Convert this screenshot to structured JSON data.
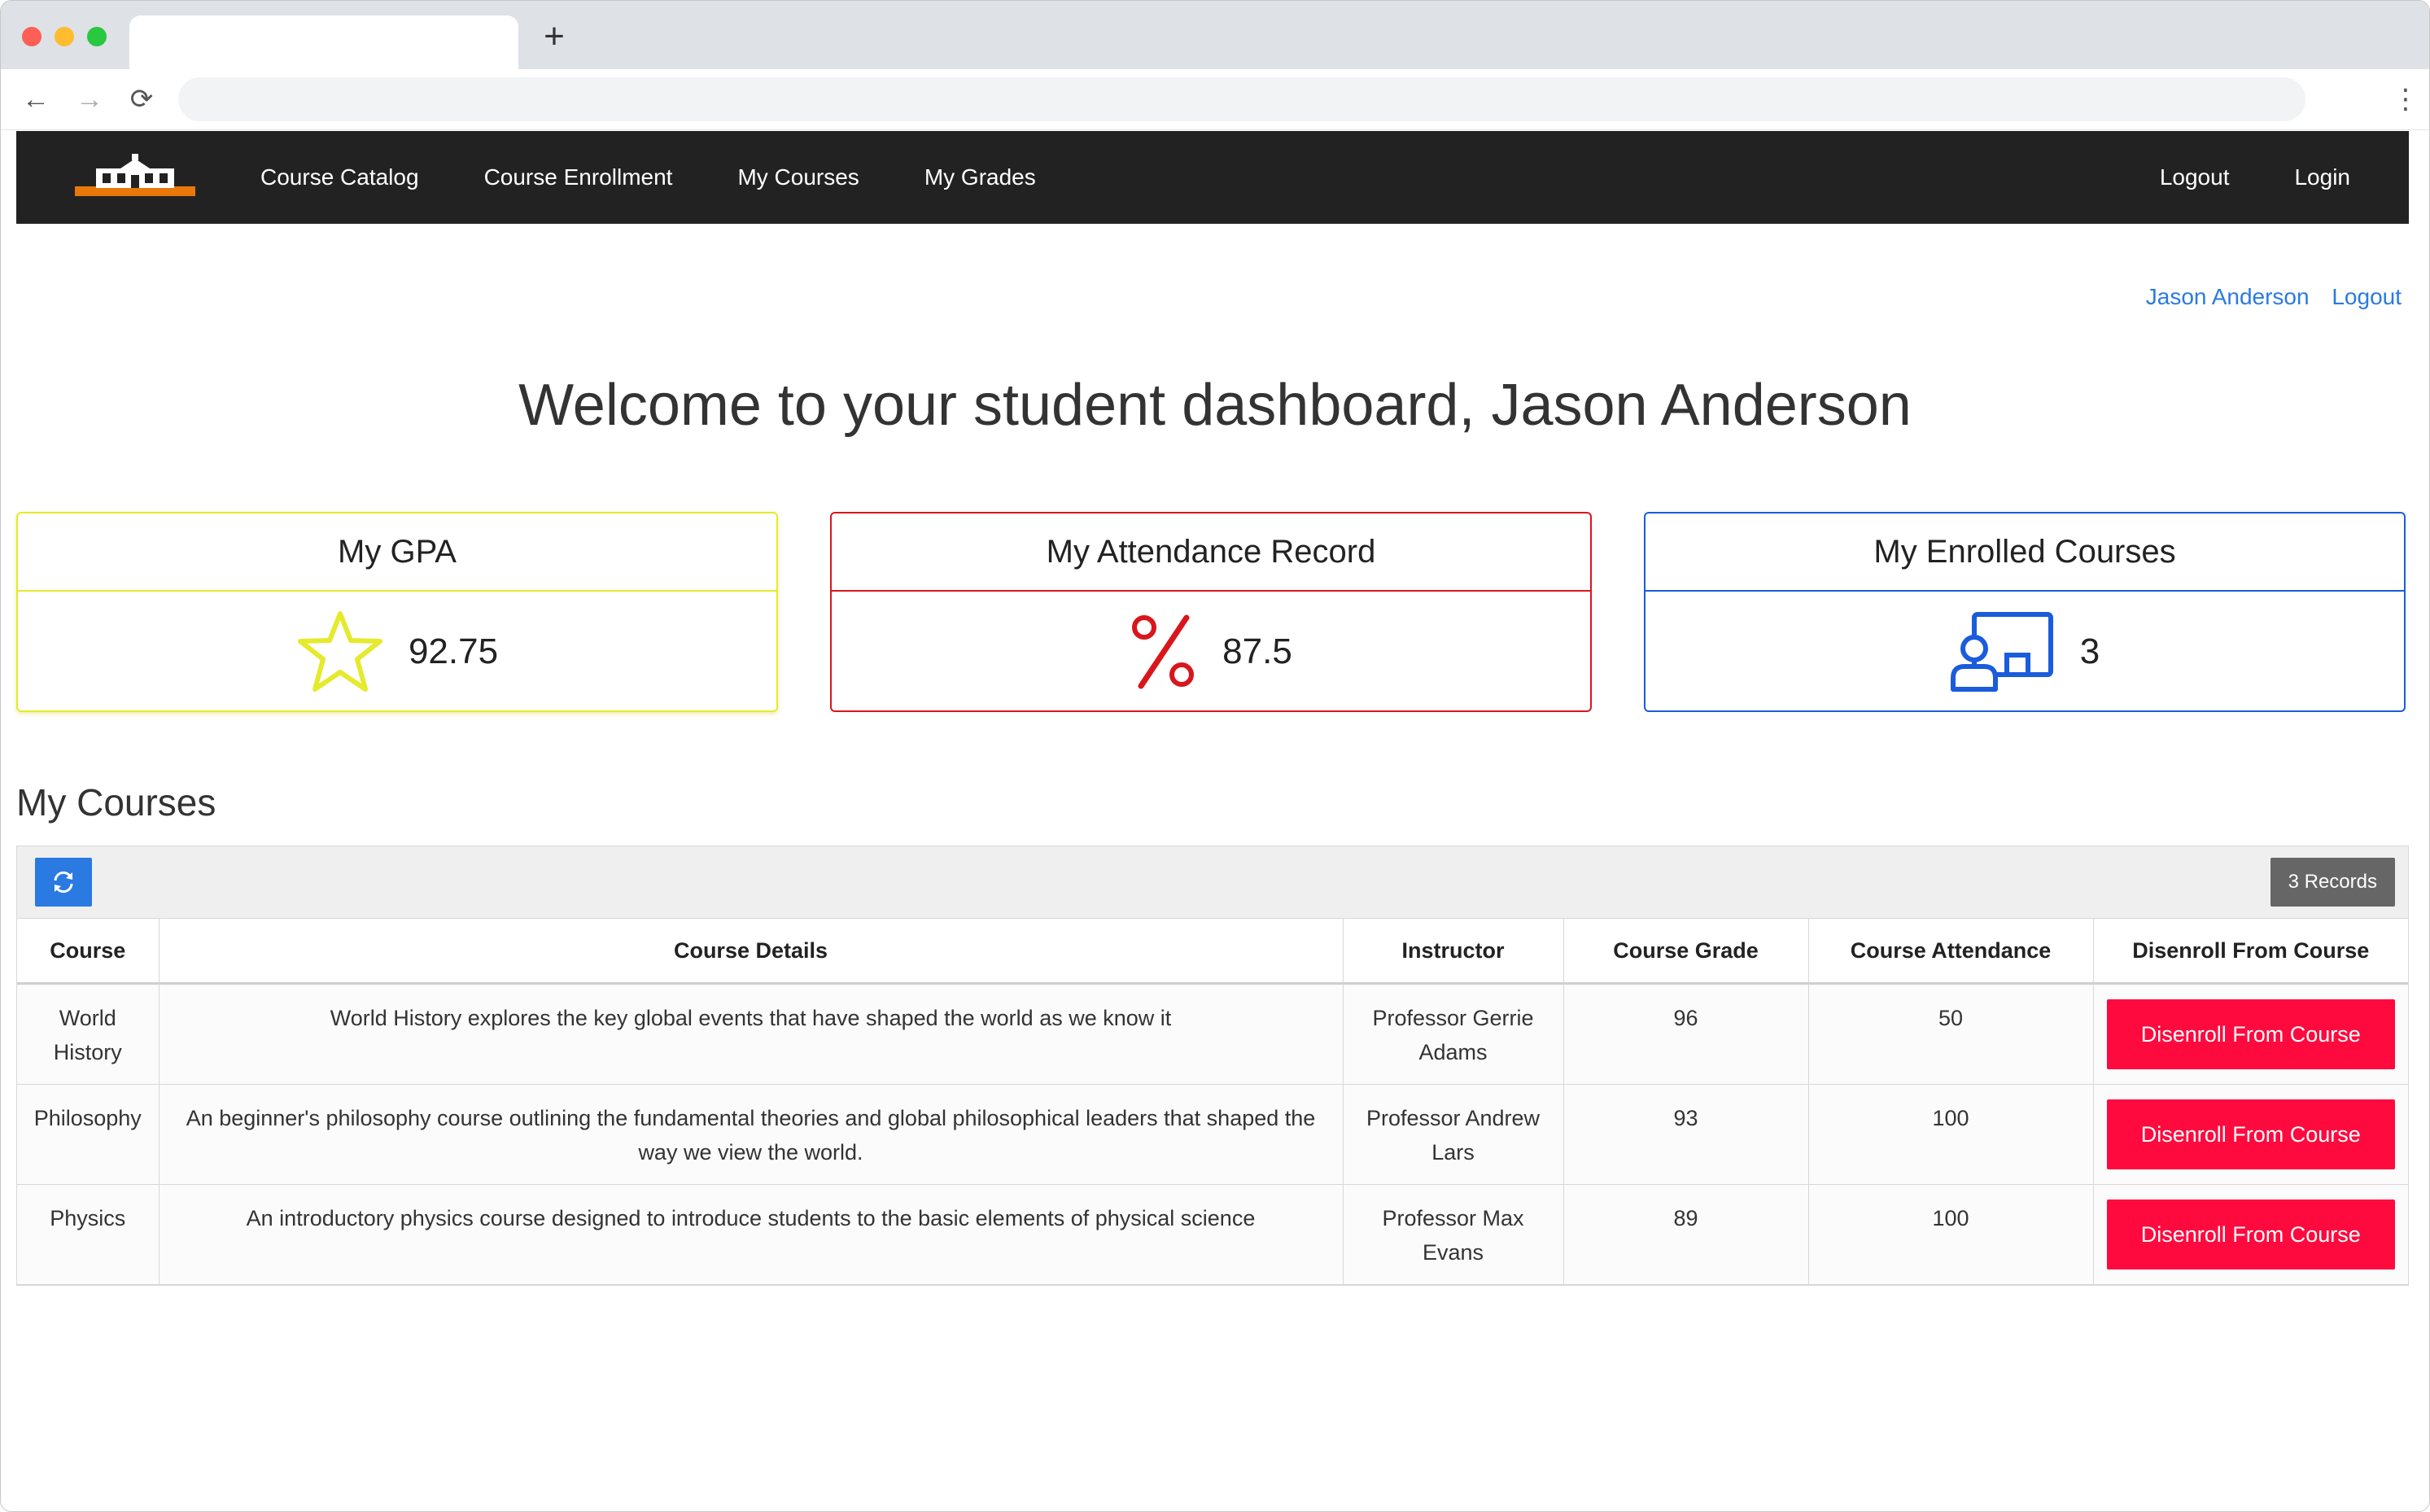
{
  "browser": {
    "url": "",
    "new_tab_symbol": "+",
    "back_symbol": "←",
    "forward_symbol": "→",
    "reload_symbol": "⟳",
    "menu_symbol": "⋮"
  },
  "navbar": {
    "logo_icon": "school-building-icon",
    "links": [
      "Course Catalog",
      "Course Enrollment",
      "My Courses",
      "My Grades"
    ],
    "right_links": [
      "Logout",
      "Login"
    ]
  },
  "user": {
    "name": "Jason Anderson",
    "logout": "Logout"
  },
  "welcome": "Welcome to your student dashboard, Jason Anderson",
  "cards": {
    "gpa": {
      "title": "My GPA",
      "value": "92.75",
      "icon": "star-icon",
      "color": "#e5ea2c"
    },
    "attendance": {
      "title": "My Attendance Record",
      "value": "87.5",
      "icon": "percent-icon",
      "color": "#d9161c"
    },
    "enrolled": {
      "title": "My Enrolled Courses",
      "value": "3",
      "icon": "teacher-board-icon",
      "color": "#1a5cdc"
    }
  },
  "courses_section": {
    "title": "My Courses",
    "records": "3 Records",
    "refresh_icon": "refresh-icon",
    "columns": [
      "Course",
      "Course Details",
      "Instructor",
      "Course Grade",
      "Course Attendance",
      "Disenroll From Course"
    ],
    "rows": [
      {
        "course": "World History",
        "details": "World History explores the key global events that have shaped the world as we know it",
        "instructor": "Professor Gerrie Adams",
        "grade": "96",
        "attendance": "50",
        "action": "Disenroll From Course"
      },
      {
        "course": "Philosophy",
        "details": "An beginner's philosophy course outlining the fundamental theories and global philosophical leaders that shaped the way we view the world.",
        "instructor": "Professor Andrew Lars",
        "grade": "93",
        "attendance": "100",
        "action": "Disenroll From Course"
      },
      {
        "course": "Physics",
        "details": "An introductory physics course designed to introduce students to the basic elements of physical science",
        "instructor": "Professor Max Evans",
        "grade": "89",
        "attendance": "100",
        "action": "Disenroll From Course"
      }
    ]
  },
  "colors": {
    "navbar": "#222222",
    "link": "#2a7ae2",
    "danger": "#ff0a3e"
  }
}
